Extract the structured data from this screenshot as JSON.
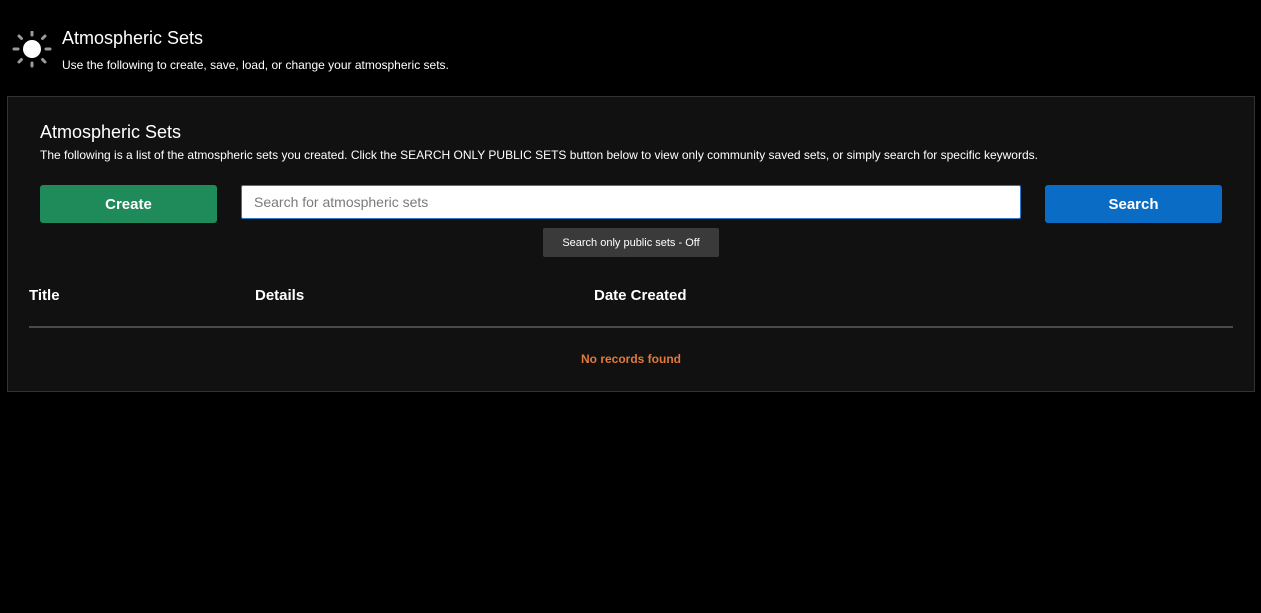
{
  "header": {
    "icon": "sun-icon",
    "title": "Atmospheric Sets",
    "subtitle": "Use the following to create, save, load, or change your atmospheric sets."
  },
  "panel": {
    "title": "Atmospheric Sets",
    "description": "The following is a list of the atmospheric sets you created. Click the SEARCH ONLY PUBLIC SETS button below to view only community saved sets, or simply search for specific keywords.",
    "create_label": "Create",
    "search": {
      "value": "",
      "placeholder": "Search for atmospheric sets"
    },
    "search_label": "Search",
    "public_toggle_label": "Search only public sets - Off",
    "table": {
      "columns": [
        "Title",
        "Details",
        "Date Created"
      ],
      "rows": [],
      "empty_message": "No records found"
    }
  },
  "colors": {
    "background": "#000000",
    "panel": "#111111",
    "create_button": "#1f8a5a",
    "search_button": "#0a6cc4",
    "empty_message": "#e07a3a"
  }
}
